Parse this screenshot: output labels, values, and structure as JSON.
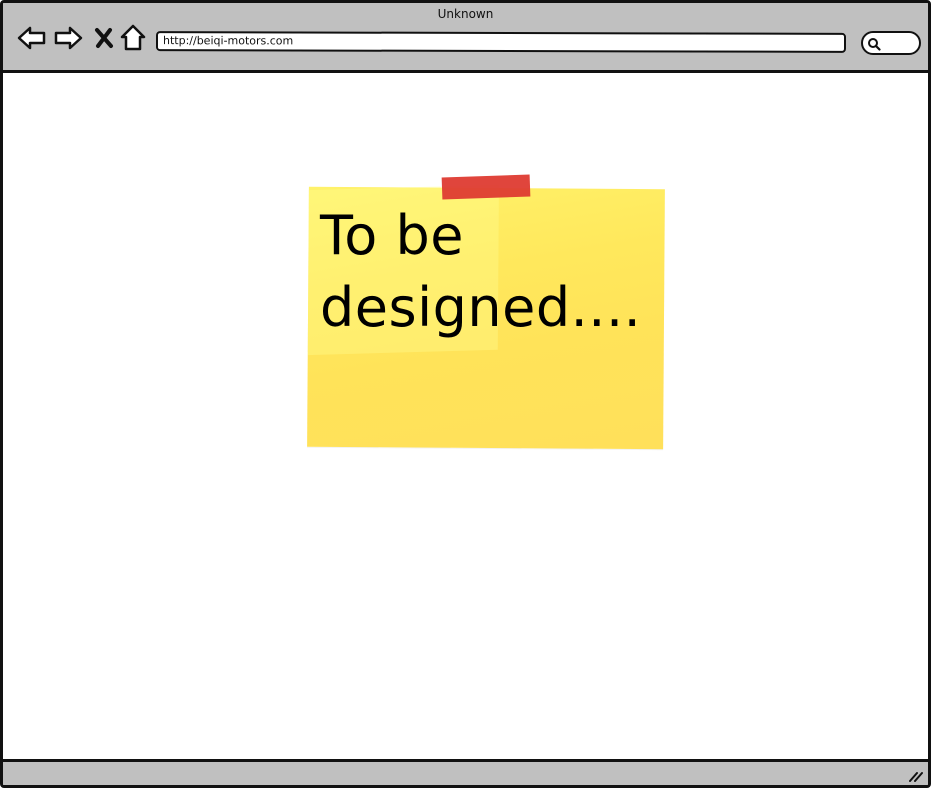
{
  "window": {
    "title": "Unknown"
  },
  "toolbar": {
    "back_icon": "back-arrow-icon",
    "forward_icon": "forward-arrow-icon",
    "stop_icon": "close-x-icon",
    "home_icon": "home-icon",
    "search_icon": "search-icon"
  },
  "address_bar": {
    "url": "http://beiqi-motors.com"
  },
  "sticky_note": {
    "text": "To be designed....",
    "color": "#ffe559",
    "tape_color": "#de3b32"
  },
  "colors": {
    "chrome": "#c0c0c0",
    "border": "#111111"
  }
}
